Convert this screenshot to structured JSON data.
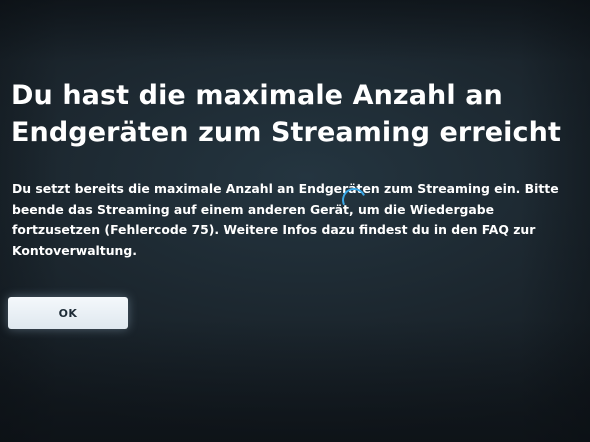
{
  "dialog": {
    "title_line1": "Du hast die maximale Anzahl an",
    "title_line2": "Endgeräten zum Streaming erreicht",
    "message_lines": [
      "Du setzt bereits die maximale Anzahl an Endgeräten zum Streaming ein. Bitte",
      "beende das Streaming auf einem anderen Gerät, um die Wiedergabe",
      "fortzusetzen (Fehlercode 75). Weitere Infos dazu findest du in den FAQ zur",
      "Kontoverwaltung."
    ],
    "ok_label": "OK"
  },
  "colors": {
    "background": "#1c272f",
    "text": "#ffffff",
    "button": "#eef3f7",
    "button_text": "#1d2b36",
    "cursor_accent": "#3aa7e6"
  }
}
